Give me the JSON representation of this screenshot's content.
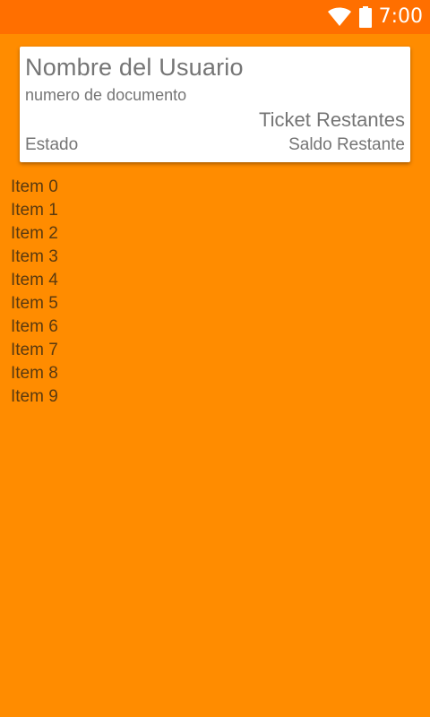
{
  "status_bar": {
    "time": "7:00",
    "icons": [
      "wifi-icon",
      "battery-icon"
    ],
    "background": "#FF6F00"
  },
  "user_card": {
    "name": "Nombre del Usuario",
    "document": "numero de documento",
    "tickets": "Ticket Restantes",
    "status": "Estado",
    "balance": "Saldo Restante"
  },
  "items": [
    "Item 0",
    "Item 1",
    "Item 2",
    "Item 3",
    "Item 4",
    "Item 5",
    "Item 6",
    "Item 7",
    "Item 8",
    "Item 9"
  ],
  "colors": {
    "background": "#FF8C00",
    "card": "#FFFFFF",
    "card_text": "#757575",
    "item_text": "#5A3A10"
  }
}
